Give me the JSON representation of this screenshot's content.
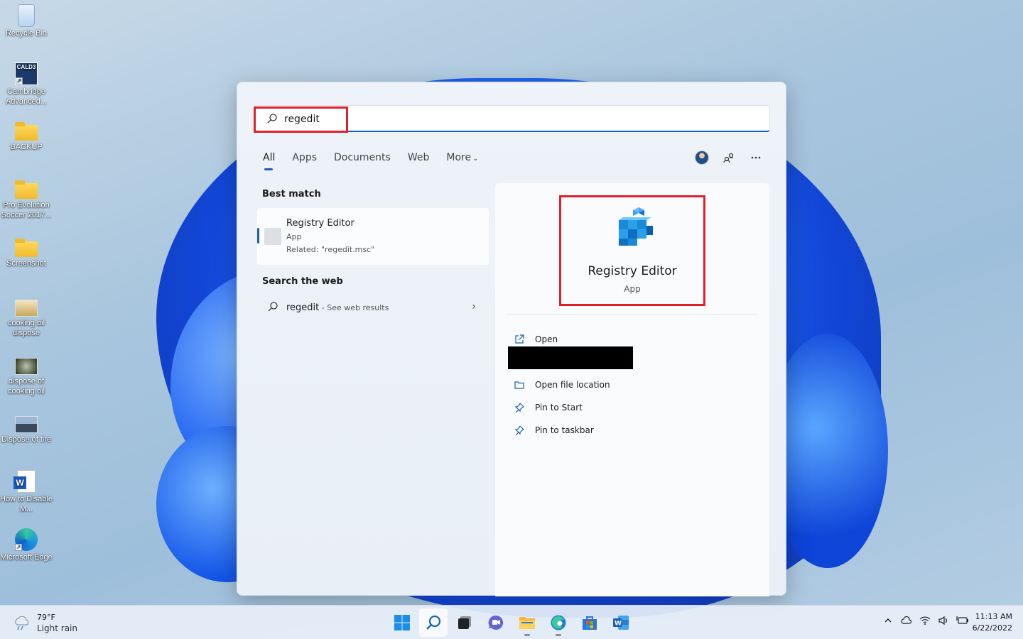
{
  "desktop": {
    "icons": [
      {
        "label": "Recycle Bin",
        "icon": "recycle-bin-icon"
      },
      {
        "label": "Cambridge Advanced...",
        "icon": "cald3-shortcut-icon",
        "badge": "CALD3"
      },
      {
        "label": "BACKUP",
        "icon": "folder-icon"
      },
      {
        "label": "Pro Evolution Soccer 2017...",
        "icon": "folder-icon"
      },
      {
        "label": "Screenshot",
        "icon": "folder-icon"
      },
      {
        "label": "cooking oil dispose",
        "icon": "image-thumbnail-icon"
      },
      {
        "label": "dispose of cooking oil",
        "icon": "image-thumbnail-icon"
      },
      {
        "label": "Dispose of tire",
        "icon": "image-thumbnail-icon"
      },
      {
        "label": "How to Disable M...",
        "icon": "word-document-icon"
      },
      {
        "label": "Microsoft Edge",
        "icon": "edge-shortcut-icon"
      }
    ]
  },
  "search": {
    "query": "regedit",
    "tabs": [
      {
        "label": "All",
        "active": true
      },
      {
        "label": "Apps"
      },
      {
        "label": "Documents"
      },
      {
        "label": "Web"
      },
      {
        "label": "More"
      }
    ],
    "more_chevron": "⌄",
    "best_match": {
      "section_title": "Best match",
      "name": "Registry Editor",
      "type": "App",
      "related": "Related: \"regedit.msc\""
    },
    "web": {
      "section_title": "Search the web",
      "query": "regedit",
      "suffix": " - See web results",
      "arrow": "›"
    },
    "preview": {
      "name": "Registry Editor",
      "type": "App",
      "actions": [
        {
          "label": "Open",
          "icon": "open-external-icon"
        },
        {
          "label": "Open file location",
          "icon": "folder-open-icon"
        },
        {
          "label": "Pin to Start",
          "icon": "pin-icon"
        },
        {
          "label": "Pin to taskbar",
          "icon": "pin-icon"
        }
      ]
    },
    "highlight_color": "#e0202c",
    "accent_color": "#1a5fb4"
  },
  "taskbar": {
    "weather": {
      "temp": "79°F",
      "condition": "Light rain"
    },
    "apps": [
      {
        "name": "start-button",
        "icon": "windows-logo-icon"
      },
      {
        "name": "search-button",
        "icon": "search-icon",
        "active": true
      },
      {
        "name": "task-view-button",
        "icon": "task-view-icon"
      },
      {
        "name": "chat-button",
        "icon": "teams-chat-icon"
      },
      {
        "name": "file-explorer-button",
        "icon": "folder-icon",
        "running": true
      },
      {
        "name": "edge-button",
        "icon": "edge-icon",
        "running": true
      },
      {
        "name": "store-button",
        "icon": "store-icon"
      },
      {
        "name": "word-button",
        "icon": "word-icon"
      }
    ],
    "clock": {
      "time": "11:13 AM",
      "date": "6/22/2022"
    }
  }
}
